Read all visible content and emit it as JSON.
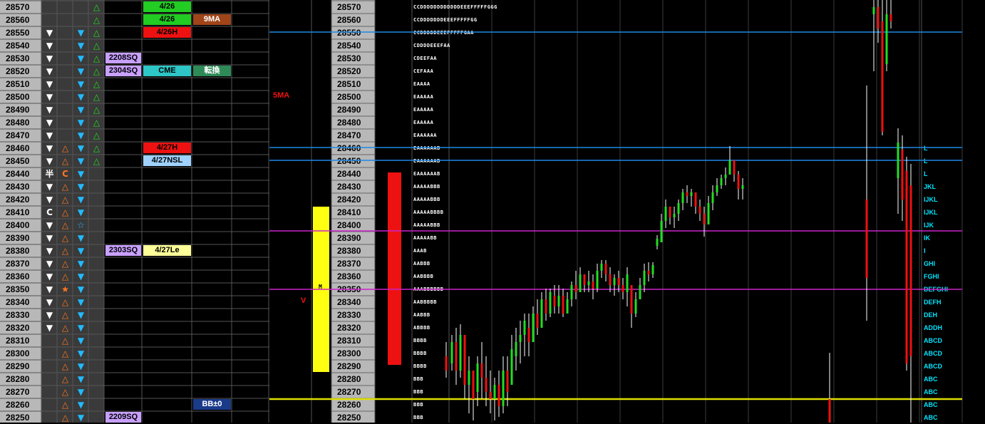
{
  "prices": [
    "28570",
    "28560",
    "28550",
    "28540",
    "28530",
    "28520",
    "28510",
    "28500",
    "28490",
    "28480",
    "28470",
    "28460",
    "28450",
    "28440",
    "28430",
    "28420",
    "28410",
    "28400",
    "28390",
    "28380",
    "28370",
    "28360",
    "28350",
    "28340",
    "28330",
    "28320",
    "28310",
    "28300",
    "28290",
    "28280",
    "28270",
    "28260",
    "28250"
  ],
  "col1": [
    "",
    "",
    "down",
    "down",
    "down",
    "down",
    "down",
    "down",
    "down",
    "down",
    "down",
    "down",
    "down",
    "半",
    "down",
    "down",
    "C",
    "down",
    "down",
    "down",
    "down",
    "down",
    "down",
    "down",
    "down",
    "down",
    "",
    "",
    "",
    "",
    "",
    "",
    ""
  ],
  "col2": [
    "",
    "",
    "",
    "",
    "",
    "",
    "",
    "",
    "",
    "",
    "",
    "up-o",
    "up-o",
    "C",
    "up-o",
    "up-o",
    "up-o",
    "up-o",
    "up-o",
    "up-o",
    "up-o",
    "up-o",
    "star-o",
    "up-o",
    "up-o",
    "up-o",
    "up-o",
    "up-o",
    "up-o",
    "up-o",
    "up-o",
    "up-o",
    "up-o"
  ],
  "col3": [
    "",
    "",
    "down",
    "down",
    "down",
    "down",
    "down",
    "down",
    "down",
    "down",
    "down",
    "down",
    "down",
    "down",
    "down",
    "down",
    "down",
    "star-b",
    "down",
    "down",
    "down",
    "down",
    "down",
    "down",
    "down",
    "down",
    "down",
    "down",
    "down",
    "down",
    "down",
    "down",
    "down"
  ],
  "col4": [
    "up-g",
    "up-g",
    "up-g",
    "up-g",
    "up-g",
    "up-g",
    "up-g",
    "up-g",
    "up-g",
    "up-g",
    "up-g",
    "up-g",
    "up-g",
    "",
    "",
    "",
    "",
    "",
    "",
    "",
    "",
    "",
    "",
    "",
    "",
    "",
    "",
    "",
    "",
    "",
    "",
    "",
    ""
  ],
  "labels": [
    {
      "row": 0,
      "col": "c5",
      "text": "4/26",
      "bg": "#22cc22",
      "fg": "#000000"
    },
    {
      "row": 1,
      "col": "c5",
      "text": "4/26",
      "bg": "#22cc22",
      "fg": "#000000"
    },
    {
      "row": 2,
      "col": "c5",
      "text": "4/26H",
      "bg": "#ee1111",
      "fg": "#000000"
    },
    {
      "row": 11,
      "col": "c5",
      "text": "4/27H",
      "bg": "#ee1111",
      "fg": "#000000"
    },
    {
      "row": 12,
      "col": "c5",
      "text": "4/27NSL",
      "bg": "#9fd2ff",
      "fg": "#000000"
    },
    {
      "row": 19,
      "col": "c5",
      "text": "4/27Le",
      "bg": "#ffff99",
      "fg": "#000000"
    },
    {
      "row": 1,
      "col": "c6",
      "text": "9MA",
      "bg": "#a0451a",
      "fg": "#ffffff"
    },
    {
      "row": 5,
      "col": "c5",
      "text": "CME",
      "bg": "#2ec6c6",
      "fg": "#000000"
    },
    {
      "row": 5,
      "col": "c6",
      "text": "転換",
      "bg": "#2e8b57",
      "fg": "#ffffff"
    },
    {
      "row": 4,
      "col": "c4",
      "text": "2208SQ",
      "bg": "#c8a0ff",
      "fg": "#000000"
    },
    {
      "row": 5,
      "col": "c4",
      "text": "2304SQ",
      "bg": "#c8a0ff",
      "fg": "#000000"
    },
    {
      "row": 19,
      "col": "c4",
      "text": "2303SQ",
      "bg": "#c8a0ff",
      "fg": "#000000"
    },
    {
      "row": 32,
      "col": "c4",
      "text": "2209SQ",
      "bg": "#c8a0ff",
      "fg": "#000000"
    },
    {
      "row": 31,
      "col": "c6",
      "text": "BB±0",
      "bg": "#1a3a8a",
      "fg": "#ffffff"
    }
  ],
  "annotations": {
    "ma5": "5MA",
    "v_mark": "V",
    "poc_mark": "M"
  },
  "tpo": [
    "CCDDDDDDDDDDDDEEEFFFFFGGG",
    "CCDDDDDDDEEEFFFFFGG",
    "CCDDDDDEEEFFFFFGAA",
    "CDDDDEEEFAA",
    "CDEEFAA",
    "CEFAAA",
    "EAAAA",
    "EAAAAA",
    "EAAAAA",
    "EAAAAA",
    "EAAAAAA",
    "EAAAAAAB",
    "EAAAAAAB",
    "EAAAAAAB",
    "AAAAABBB",
    "AAAAABBB",
    "AAAAABBBB",
    "AAAAABBB",
    "AAAAABB",
    "AAAB",
    "AABBB",
    "AABBBB",
    "AAABBBBBB",
    "AABBBBB",
    "AABBB",
    "ABBBB",
    "BBBB",
    "BBBB",
    "BBBB",
    "BBB",
    "BBB",
    "BBB",
    "BBB"
  ],
  "right_labels": [
    "",
    "",
    "",
    "",
    "",
    "",
    "",
    "",
    "",
    "",
    "",
    "L",
    "L",
    "L",
    "JKL",
    "IJKL",
    "IJKL",
    "IJK",
    "IK",
    "I",
    "GHI",
    "FGHI",
    "DEFGHI",
    "DEFH",
    "DEH",
    "ADDH",
    "ABCD",
    "ABCD",
    "ABCD",
    "ABC",
    "ABC",
    "ABC",
    "ABC"
  ],
  "colors": {
    "up": "#22dd22",
    "down": "#ee1111",
    "blue_line": "#1e88e5",
    "magenta_line": "#cc22cc",
    "yellow_line": "#dddd00",
    "cyan_label": "#00e5ff"
  }
}
